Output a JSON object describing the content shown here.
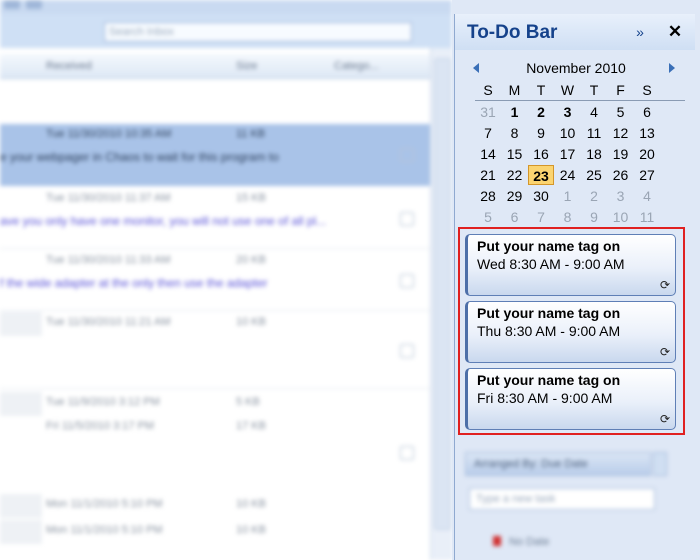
{
  "mail_list": {
    "search_placeholder": "Search Inbox",
    "columns": [
      "Received",
      "Size",
      "Catego..."
    ],
    "rows": [
      {
        "date": "Tue 11/30/2010 10:35 AM",
        "size": "11 KB",
        "preview": "e your webpager in Chaos to wait for this program to",
        "selected": true
      },
      {
        "date": "Tue 11/30/2010 11:37 AM",
        "size": "15 KB",
        "preview": "ave you only have one monitor, you will not use one of all pl...",
        "selected": false
      },
      {
        "date": "Tue 11/30/2010 11:33 AM",
        "size": "20 KB",
        "preview": "f the wide adapter at the only then use the adapter",
        "selected": false
      },
      {
        "date": "Tue 11/30/2010 11:21 AM",
        "size": "10 KB",
        "preview": "",
        "selected": false
      },
      {
        "date": "Tue 11/9/2010 3:12 PM",
        "size": "5 KB",
        "preview": "",
        "selected": false
      },
      {
        "date": "Fri 11/5/2010 3:17 PM",
        "size": "17 KB",
        "preview": "",
        "selected": false
      },
      {
        "date": "Mon 11/1/2010 5:10 PM",
        "size": "10 KB",
        "preview": "",
        "selected": false
      },
      {
        "date": "Mon 11/1/2010 5:10 PM",
        "size": "10 KB",
        "preview": "",
        "selected": false
      }
    ]
  },
  "todo_bar": {
    "title": "To-Do Bar",
    "expand_glyph": "»",
    "close_glyph": "✕"
  },
  "calendar": {
    "month_label": "November 2010",
    "weekdays": [
      "S",
      "M",
      "T",
      "W",
      "T",
      "F",
      "S"
    ],
    "weeks": [
      [
        {
          "d": "31",
          "m": true
        },
        {
          "d": "1",
          "b": true
        },
        {
          "d": "2",
          "b": true
        },
        {
          "d": "3",
          "b": true
        },
        {
          "d": "4"
        },
        {
          "d": "5"
        },
        {
          "d": "6"
        }
      ],
      [
        {
          "d": "7"
        },
        {
          "d": "8"
        },
        {
          "d": "9"
        },
        {
          "d": "10"
        },
        {
          "d": "11"
        },
        {
          "d": "12"
        },
        {
          "d": "13"
        }
      ],
      [
        {
          "d": "14"
        },
        {
          "d": "15"
        },
        {
          "d": "16"
        },
        {
          "d": "17"
        },
        {
          "d": "18"
        },
        {
          "d": "19"
        },
        {
          "d": "20"
        }
      ],
      [
        {
          "d": "21"
        },
        {
          "d": "22"
        },
        {
          "d": "23",
          "today": true
        },
        {
          "d": "24"
        },
        {
          "d": "25"
        },
        {
          "d": "26"
        },
        {
          "d": "27"
        }
      ],
      [
        {
          "d": "28"
        },
        {
          "d": "29"
        },
        {
          "d": "30"
        },
        {
          "d": "1",
          "m": true
        },
        {
          "d": "2",
          "m": true
        },
        {
          "d": "3",
          "m": true
        },
        {
          "d": "4",
          "m": true
        }
      ],
      [
        {
          "d": "5",
          "m": true
        },
        {
          "d": "6",
          "m": true
        },
        {
          "d": "7",
          "m": true
        },
        {
          "d": "8",
          "m": true
        },
        {
          "d": "9",
          "m": true
        },
        {
          "d": "10",
          "m": true
        },
        {
          "d": "11",
          "m": true
        }
      ]
    ]
  },
  "appointments": [
    {
      "title": "Put your name tag on",
      "time": "Wed 8:30 AM - 9:00 AM",
      "recurring_icon": "recurring-icon"
    },
    {
      "title": "Put your name tag on",
      "time": "Thu 8:30 AM - 9:00 AM",
      "recurring_icon": "recurring-icon"
    },
    {
      "title": "Put your name tag on",
      "time": "Fri 8:30 AM - 9:00 AM",
      "recurring_icon": "recurring-icon"
    }
  ],
  "tasks": {
    "arranged_by": "Arranged By: Due Date",
    "new_task_placeholder": "Type a new task",
    "first_item": "No Date"
  },
  "colors": {
    "accent": "#15428b",
    "highlight_border": "#e02020",
    "today": "#fbd470"
  }
}
